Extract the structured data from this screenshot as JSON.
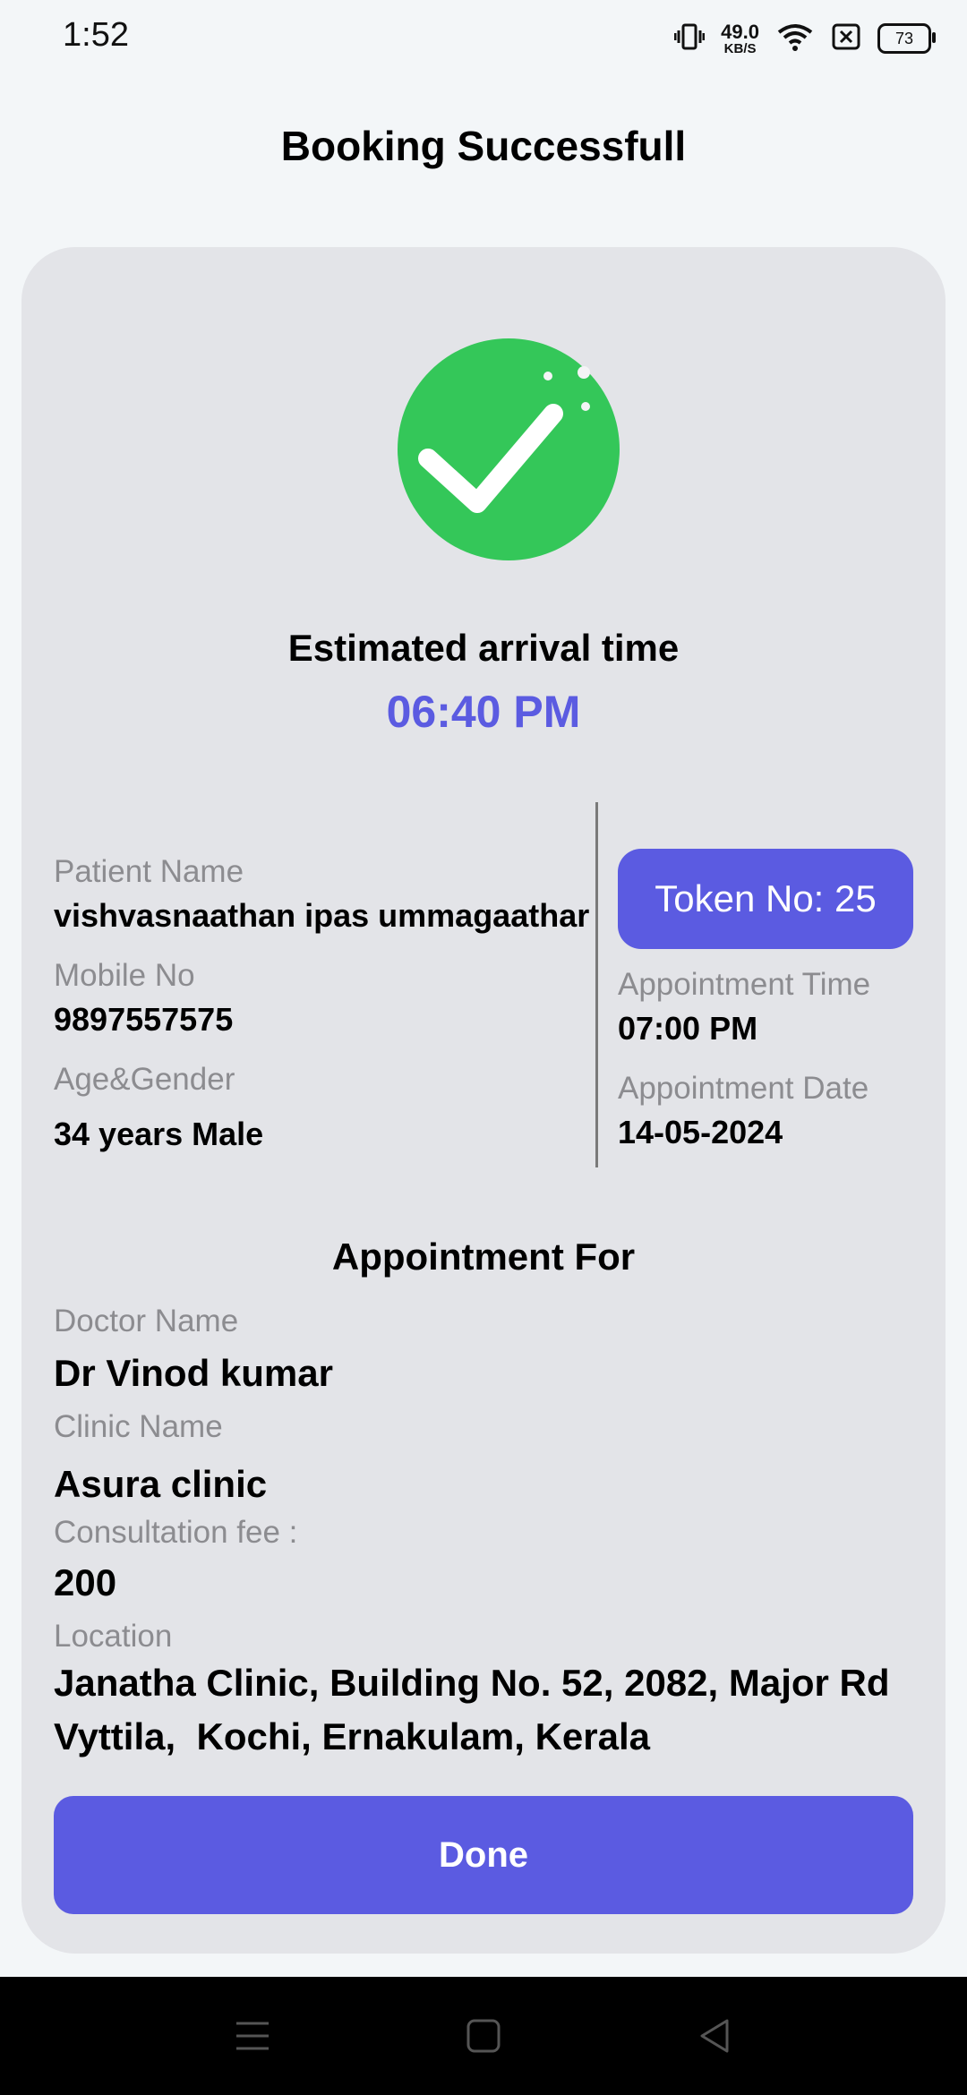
{
  "status_bar": {
    "time": "1:52",
    "net_speed_value": "49.0",
    "net_speed_unit": "KB/S",
    "battery": "73",
    "icons": [
      "vibrate-icon",
      "wifi-icon",
      "sim-off-icon",
      "battery-icon"
    ]
  },
  "header": {
    "title": "Booking Successfull"
  },
  "arrival": {
    "label": "Estimated arrival time",
    "time": "06:40 PM"
  },
  "patient": {
    "name_label": "Patient Name",
    "name": "vishvasnaathan ipas ummagaathar",
    "mobile_label": "Mobile No",
    "mobile": "9897557575",
    "age_gender_label": "Age&Gender",
    "age_gender": "34 years Male"
  },
  "token": {
    "label": "Token No: 25"
  },
  "appointment": {
    "time_label": "Appointment Time",
    "time": "07:00 PM",
    "date_label": "Appointment Date",
    "date": "14-05-2024"
  },
  "appointment_for": {
    "title": "Appointment For",
    "doctor_label": "Doctor Name",
    "doctor": "Dr Vinod kumar",
    "clinic_label": "Clinic Name",
    "clinic": "Asura clinic",
    "fee_label": "Consultation fee :",
    "fee": "200",
    "location_label": "Location",
    "location_line1": "Janatha Clinic, Building No. 52, 2082, Major Rd",
    "location_line2": "Vyttila,  Kochi, Ernakulam, Kerala"
  },
  "actions": {
    "done_label": "Done"
  },
  "colors": {
    "accent": "#5B5BE1",
    "success": "#34C759",
    "card_bg": "#E3E4E8",
    "page_bg": "#F3F6F8"
  },
  "nav_bar": {
    "icons": [
      "menu-icon",
      "home-icon",
      "back-icon"
    ]
  }
}
